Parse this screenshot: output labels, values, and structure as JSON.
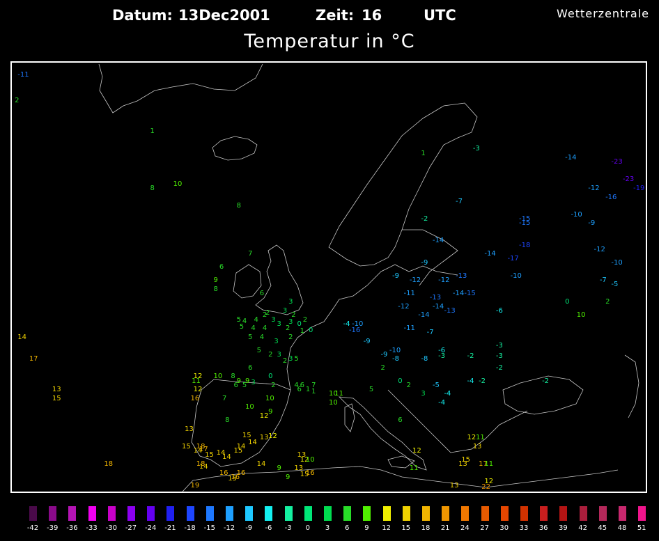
{
  "header": {
    "datum_label": "Datum:",
    "datum_value": "13Dec2001",
    "zeit_label": "Zeit:",
    "zeit_value": "16",
    "utc_label": "UTC",
    "title": "Temperatur in °C",
    "credit": "Wetterzentrale"
  },
  "legend": {
    "values": [
      "-42",
      "-39",
      "-36",
      "-33",
      "-30",
      "-27",
      "-24",
      "-21",
      "-18",
      "-15",
      "-12",
      "-9",
      "-6",
      "-3",
      "0",
      "3",
      "6",
      "9",
      "12",
      "15",
      "18",
      "21",
      "24",
      "27",
      "30",
      "33",
      "36",
      "39",
      "42",
      "45",
      "48",
      "51"
    ],
    "colors": [
      "#4a0a4a",
      "#8a0a8a",
      "#b414b4",
      "#f000f0",
      "#c800c8",
      "#8c00f0",
      "#6400f0",
      "#2020f0",
      "#1e46ff",
      "#1e78ff",
      "#1ea0ff",
      "#1ec8ff",
      "#14f0f0",
      "#14f0a0",
      "#00e678",
      "#00dc50",
      "#28dc28",
      "#50f000",
      "#f0f000",
      "#f0d200",
      "#f0b400",
      "#f09600",
      "#f07800",
      "#e65a00",
      "#e64600",
      "#d23200",
      "#c81e1e",
      "#b41414",
      "#aa1e3c",
      "#b4285a",
      "#c8286e",
      "#f0148c"
    ]
  },
  "observations": [
    {
      "t": "-11",
      "lon": -45,
      "lat": 77,
      "c": "#1e78ff"
    },
    {
      "t": "2",
      "lon": -45.5,
      "lat": 74,
      "c": "#28dc28"
    },
    {
      "t": "1",
      "lon": -22,
      "lat": 70.5,
      "c": "#28dc28"
    },
    {
      "t": "10",
      "lon": -18,
      "lat": 64.5,
      "c": "#50f000"
    },
    {
      "t": "8",
      "lon": -22,
      "lat": 64,
      "c": "#28dc28"
    },
    {
      "t": "8",
      "lon": -7,
      "lat": 62,
      "c": "#28dc28"
    },
    {
      "t": "1",
      "lon": 25,
      "lat": 68,
      "c": "#28dc28"
    },
    {
      "t": "-3",
      "lon": 34,
      "lat": 68.5,
      "c": "#14f0a0"
    },
    {
      "t": "-14",
      "lon": 50,
      "lat": 67.5,
      "c": "#1ea0ff"
    },
    {
      "t": "-23",
      "lon": 58,
      "lat": 67,
      "c": "#6400f0"
    },
    {
      "t": "-23",
      "lon": 60,
      "lat": 65,
      "c": "#6400f0"
    },
    {
      "t": "-19",
      "lon": 64,
      "lat": 64,
      "c": "#2020f0"
    },
    {
      "t": "-12",
      "lon": 54,
      "lat": 64,
      "c": "#1ea0ff"
    },
    {
      "t": "-16",
      "lon": 57,
      "lat": 63,
      "c": "#1e78ff"
    },
    {
      "t": "-7",
      "lon": 31,
      "lat": 62.5,
      "c": "#1ec8ff"
    },
    {
      "t": "-2",
      "lon": 25,
      "lat": 60.5,
      "c": "#14f0a0"
    },
    {
      "t": "-15",
      "lon": 42,
      "lat": 60.5,
      "c": "#1e78ff"
    },
    {
      "t": "-15",
      "lon": 42,
      "lat": 60,
      "c": "#1e78ff"
    },
    {
      "t": "-10",
      "lon": 51,
      "lat": 61,
      "c": "#1ea0ff"
    },
    {
      "t": "-9",
      "lon": 54,
      "lat": 60,
      "c": "#1ea0ff"
    },
    {
      "t": "-14",
      "lon": 27,
      "lat": 58,
      "c": "#1ea0ff"
    },
    {
      "t": "-18",
      "lon": 42,
      "lat": 57.5,
      "c": "#1e46ff"
    },
    {
      "t": "-12",
      "lon": 55,
      "lat": 57,
      "c": "#1ea0ff"
    },
    {
      "t": "-14",
      "lon": 36,
      "lat": 56.5,
      "c": "#1ea0ff"
    },
    {
      "t": "-17",
      "lon": 40,
      "lat": 56,
      "c": "#1e46ff"
    },
    {
      "t": "-10",
      "lon": 58,
      "lat": 55.5,
      "c": "#1ea0ff"
    },
    {
      "t": "-9",
      "lon": 25,
      "lat": 55.5,
      "c": "#1ec8ff"
    },
    {
      "t": "-10",
      "lon": 40.5,
      "lat": 54,
      "c": "#1ea0ff"
    },
    {
      "t": "-7",
      "lon": 56,
      "lat": 53.5,
      "c": "#1ec8ff"
    },
    {
      "t": "-5",
      "lon": 58,
      "lat": 53,
      "c": "#1ec8ff"
    },
    {
      "t": "-9",
      "lon": 20,
      "lat": 54,
      "c": "#1ec8ff"
    },
    {
      "t": "-12",
      "lon": 23,
      "lat": 53.5,
      "c": "#1ea0ff"
    },
    {
      "t": "-12",
      "lon": 28,
      "lat": 53.5,
      "c": "#1ea0ff"
    },
    {
      "t": "-13",
      "lon": 31,
      "lat": 54,
      "c": "#1e78ff"
    },
    {
      "t": "-11",
      "lon": 22,
      "lat": 52,
      "c": "#1ea0ff"
    },
    {
      "t": "-13",
      "lon": 26.5,
      "lat": 51.5,
      "c": "#1e78ff"
    },
    {
      "t": "-14",
      "lon": 30.5,
      "lat": 52,
      "c": "#1ea0ff"
    },
    {
      "t": "-15",
      "lon": 32.5,
      "lat": 52,
      "c": "#1e78ff"
    },
    {
      "t": "-12",
      "lon": 21,
      "lat": 50.5,
      "c": "#1ea0ff"
    },
    {
      "t": "-14",
      "lon": 24.5,
      "lat": 49.5,
      "c": "#1ea0ff"
    },
    {
      "t": "-14",
      "lon": 27,
      "lat": 50.5,
      "c": "#1ea0ff"
    },
    {
      "t": "-13",
      "lon": 29,
      "lat": 50,
      "c": "#1e78ff"
    },
    {
      "t": "-6",
      "lon": 38,
      "lat": 50,
      "c": "#14f0f0"
    },
    {
      "t": "0",
      "lon": 50,
      "lat": 51,
      "c": "#00e678"
    },
    {
      "t": "10",
      "lon": 52,
      "lat": 49.5,
      "c": "#50f000"
    },
    {
      "t": "2",
      "lon": 57,
      "lat": 51,
      "c": "#28dc28"
    },
    {
      "t": "-10",
      "lon": 13,
      "lat": 48.5,
      "c": "#1ea0ff"
    },
    {
      "t": "-4",
      "lon": 11.5,
      "lat": 48.5,
      "c": "#14f0f0"
    },
    {
      "t": "-16",
      "lon": 12.5,
      "lat": 47.8,
      "c": "#1e78ff"
    },
    {
      "t": "-11",
      "lon": 22,
      "lat": 48,
      "c": "#1ea0ff"
    },
    {
      "t": "-7",
      "lon": 26,
      "lat": 47.5,
      "c": "#1ec8ff"
    },
    {
      "t": "-9",
      "lon": 15,
      "lat": 46.5,
      "c": "#1ec8ff"
    },
    {
      "t": "-10",
      "lon": 19.5,
      "lat": 45.5,
      "c": "#1ea0ff"
    },
    {
      "t": "-9",
      "lon": 18,
      "lat": 45,
      "c": "#1ec8ff"
    },
    {
      "t": "-8",
      "lon": 20,
      "lat": 44.5,
      "c": "#1ec8ff"
    },
    {
      "t": "-8",
      "lon": 25,
      "lat": 44.5,
      "c": "#1ec8ff"
    },
    {
      "t": "-6",
      "lon": 28,
      "lat": 45.5,
      "c": "#14f0f0"
    },
    {
      "t": "-3",
      "lon": 28,
      "lat": 44.8,
      "c": "#14f0a0"
    },
    {
      "t": "-2",
      "lon": 33,
      "lat": 44.8,
      "c": "#14f0a0"
    },
    {
      "t": "-3",
      "lon": 38,
      "lat": 46,
      "c": "#14f0a0"
    },
    {
      "t": "-3",
      "lon": 38,
      "lat": 44.8,
      "c": "#14f0a0"
    },
    {
      "t": "-2",
      "lon": 38,
      "lat": 43.5,
      "c": "#14f0a0"
    },
    {
      "t": "-2",
      "lon": 46,
      "lat": 42,
      "c": "#14f0a0"
    },
    {
      "t": "-4",
      "lon": 33,
      "lat": 42,
      "c": "#14f0f0"
    },
    {
      "t": "-2",
      "lon": 35,
      "lat": 42,
      "c": "#14f0a0"
    },
    {
      "t": "-5",
      "lon": 27,
      "lat": 41.5,
      "c": "#1ec8ff"
    },
    {
      "t": "-4",
      "lon": 29,
      "lat": 40.5,
      "c": "#14f0f0"
    },
    {
      "t": "-4",
      "lon": 28,
      "lat": 39.5,
      "c": "#14f0f0"
    },
    {
      "t": "0",
      "lon": 21,
      "lat": 42,
      "c": "#00e678"
    },
    {
      "t": "2",
      "lon": 22.5,
      "lat": 41.5,
      "c": "#28dc28"
    },
    {
      "t": "3",
      "lon": 25,
      "lat": 40.5,
      "c": "#00dc50"
    },
    {
      "t": "5",
      "lon": 16,
      "lat": 41,
      "c": "#28dc28"
    },
    {
      "t": "2",
      "lon": 18,
      "lat": 43.5,
      "c": "#28dc28"
    },
    {
      "t": "6",
      "lon": 21,
      "lat": 37.5,
      "c": "#28dc28"
    },
    {
      "t": "12",
      "lon": 23.5,
      "lat": 34,
      "c": "#f0f000"
    },
    {
      "t": "11",
      "lon": 23,
      "lat": 32,
      "c": "#50f000"
    },
    {
      "t": "12",
      "lon": 33,
      "lat": 35.5,
      "c": "#f0f000"
    },
    {
      "t": "11",
      "lon": 34.5,
      "lat": 35.5,
      "c": "#50f000"
    },
    {
      "t": "13",
      "lon": 34,
      "lat": 34.5,
      "c": "#f0d200"
    },
    {
      "t": "15",
      "lon": 32,
      "lat": 33,
      "c": "#f0d200"
    },
    {
      "t": "13",
      "lon": 31.5,
      "lat": 32.5,
      "c": "#f0d200"
    },
    {
      "t": "17",
      "lon": 35,
      "lat": 32.5,
      "c": "#f0b400"
    },
    {
      "t": "11",
      "lon": 36,
      "lat": 32.5,
      "c": "#50f000"
    },
    {
      "t": "12",
      "lon": 36,
      "lat": 30.5,
      "c": "#f0f000"
    },
    {
      "t": "22",
      "lon": 35.5,
      "lat": 29,
      "c": "#f09600"
    },
    {
      "t": "6",
      "lon": -10,
      "lat": 55,
      "c": "#28dc28"
    },
    {
      "t": "7",
      "lon": -5,
      "lat": 56.5,
      "c": "#28dc28"
    },
    {
      "t": "9",
      "lon": -11,
      "lat": 53.5,
      "c": "#50f000"
    },
    {
      "t": "8",
      "lon": -11,
      "lat": 52.5,
      "c": "#28dc28"
    },
    {
      "t": "6",
      "lon": -3,
      "lat": 52,
      "c": "#28dc28"
    },
    {
      "t": "3",
      "lon": 2,
      "lat": 51,
      "c": "#00dc50"
    },
    {
      "t": "3",
      "lon": 1,
      "lat": 50,
      "c": "#00dc50"
    },
    {
      "t": "2",
      "lon": -2.5,
      "lat": 49.5,
      "c": "#28dc28"
    },
    {
      "t": "4",
      "lon": -4,
      "lat": 49,
      "c": "#28dc28"
    },
    {
      "t": "2",
      "lon": -2,
      "lat": 49.8,
      "c": "#28dc28"
    },
    {
      "t": "3",
      "lon": -1,
      "lat": 49,
      "c": "#00dc50"
    },
    {
      "t": "2",
      "lon": 2.5,
      "lat": 49.5,
      "c": "#28dc28"
    },
    {
      "t": "2",
      "lon": 4.5,
      "lat": 49,
      "c": "#28dc28"
    },
    {
      "t": "5",
      "lon": -7,
      "lat": 49,
      "c": "#28dc28"
    },
    {
      "t": "4",
      "lon": -6,
      "lat": 48.8,
      "c": "#28dc28"
    },
    {
      "t": "5",
      "lon": -6.5,
      "lat": 48.2,
      "c": "#28dc28"
    },
    {
      "t": "4",
      "lon": -4.5,
      "lat": 48,
      "c": "#28dc28"
    },
    {
      "t": "4",
      "lon": -2.5,
      "lat": 48,
      "c": "#28dc28"
    },
    {
      "t": "3",
      "lon": 0,
      "lat": 48.5,
      "c": "#00dc50"
    },
    {
      "t": "2",
      "lon": 1.5,
      "lat": 48,
      "c": "#28dc28"
    },
    {
      "t": "3",
      "lon": 2,
      "lat": 48.7,
      "c": "#00dc50"
    },
    {
      "t": "0",
      "lon": 3.5,
      "lat": 48.5,
      "c": "#00e678"
    },
    {
      "t": "1",
      "lon": 4,
      "lat": 47.7,
      "c": "#28dc28"
    },
    {
      "t": "0",
      "lon": 5.5,
      "lat": 47.8,
      "c": "#00e678"
    },
    {
      "t": "5",
      "lon": -5,
      "lat": 47,
      "c": "#28dc28"
    },
    {
      "t": "4",
      "lon": -3,
      "lat": 47,
      "c": "#28dc28"
    },
    {
      "t": "3",
      "lon": -0.5,
      "lat": 46.5,
      "c": "#00dc50"
    },
    {
      "t": "2",
      "lon": 2,
      "lat": 47,
      "c": "#28dc28"
    },
    {
      "t": "5",
      "lon": -3.5,
      "lat": 45.5,
      "c": "#28dc28"
    },
    {
      "t": "2",
      "lon": -1.5,
      "lat": 45,
      "c": "#28dc28"
    },
    {
      "t": "3",
      "lon": 0,
      "lat": 45,
      "c": "#00dc50"
    },
    {
      "t": "2",
      "lon": 1,
      "lat": 44.3,
      "c": "#28dc28"
    },
    {
      "t": "3",
      "lon": 2,
      "lat": 44.5,
      "c": "#00dc50"
    },
    {
      "t": "5",
      "lon": 3,
      "lat": 44.5,
      "c": "#28dc28"
    },
    {
      "t": "6",
      "lon": -5,
      "lat": 43.5,
      "c": "#28dc28"
    },
    {
      "t": "0",
      "lon": -1.5,
      "lat": 42.5,
      "c": "#00e678"
    },
    {
      "t": "2",
      "lon": -1,
      "lat": 41.5,
      "c": "#28dc28"
    },
    {
      "t": "4",
      "lon": 3,
      "lat": 41.5,
      "c": "#28dc28"
    },
    {
      "t": "6",
      "lon": 3.5,
      "lat": 41,
      "c": "#28dc28"
    },
    {
      "t": "1",
      "lon": 5,
      "lat": 41,
      "c": "#28dc28"
    },
    {
      "t": "7",
      "lon": 6,
      "lat": 41.5,
      "c": "#28dc28"
    },
    {
      "t": "6",
      "lon": 4,
      "lat": 41.5,
      "c": "#28dc28"
    },
    {
      "t": "1",
      "lon": 6,
      "lat": 40.8,
      "c": "#28dc28"
    },
    {
      "t": "8",
      "lon": -8,
      "lat": 42.5,
      "c": "#28dc28"
    },
    {
      "t": "9",
      "lon": -7,
      "lat": 42,
      "c": "#50f000"
    },
    {
      "t": "9",
      "lon": -5.5,
      "lat": 42,
      "c": "#50f000"
    },
    {
      "t": "5",
      "lon": -6,
      "lat": 41.5,
      "c": "#28dc28"
    },
    {
      "t": "6",
      "lon": -7.5,
      "lat": 41.5,
      "c": "#28dc28"
    },
    {
      "t": "3",
      "lon": -4.5,
      "lat": 41.8,
      "c": "#00dc50"
    },
    {
      "t": "10",
      "lon": -11,
      "lat": 42.5,
      "c": "#50f000"
    },
    {
      "t": "12",
      "lon": -14.5,
      "lat": 42.5,
      "c": "#f0f000"
    },
    {
      "t": "11",
      "lon": -14.8,
      "lat": 42,
      "c": "#50f000"
    },
    {
      "t": "12",
      "lon": -14.5,
      "lat": 41,
      "c": "#f0f000"
    },
    {
      "t": "16",
      "lon": -15,
      "lat": 40,
      "c": "#f0b400"
    },
    {
      "t": "7",
      "lon": -9.5,
      "lat": 40,
      "c": "#28dc28"
    },
    {
      "t": "10",
      "lon": -5.5,
      "lat": 39,
      "c": "#50f000"
    },
    {
      "t": "10",
      "lon": -2,
      "lat": 40,
      "c": "#50f000"
    },
    {
      "t": "9",
      "lon": -1.5,
      "lat": 38.5,
      "c": "#50f000"
    },
    {
      "t": "12",
      "lon": -3,
      "lat": 38,
      "c": "#f0f000"
    },
    {
      "t": "8",
      "lon": -9,
      "lat": 37.5,
      "c": "#28dc28"
    },
    {
      "t": "13",
      "lon": -16,
      "lat": 36.5,
      "c": "#f0d200"
    },
    {
      "t": "15",
      "lon": -6,
      "lat": 35.8,
      "c": "#f0d200"
    },
    {
      "t": "13",
      "lon": -3,
      "lat": 35.5,
      "c": "#f0d200"
    },
    {
      "t": "12",
      "lon": -1.5,
      "lat": 35.7,
      "c": "#f0f000"
    },
    {
      "t": "15",
      "lon": -16.5,
      "lat": 34.5,
      "c": "#f0d200"
    },
    {
      "t": "18",
      "lon": -14,
      "lat": 34.5,
      "c": "#f0b400"
    },
    {
      "t": "17",
      "lon": -13.5,
      "lat": 34.2,
      "c": "#f0b400"
    },
    {
      "t": "14",
      "lon": -14.5,
      "lat": 34,
      "c": "#f0d200"
    },
    {
      "t": "15",
      "lon": -12.5,
      "lat": 33.5,
      "c": "#f0d200"
    },
    {
      "t": "14",
      "lon": -10.5,
      "lat": 33.8,
      "c": "#f0d200"
    },
    {
      "t": "14",
      "lon": -9.5,
      "lat": 33.3,
      "c": "#f0d200"
    },
    {
      "t": "15",
      "lon": -7.5,
      "lat": 34,
      "c": "#f0d200"
    },
    {
      "t": "14",
      "lon": -7,
      "lat": 34.5,
      "c": "#f0d200"
    },
    {
      "t": "14",
      "lon": -5,
      "lat": 35,
      "c": "#f0d200"
    },
    {
      "t": "18",
      "lon": -14,
      "lat": 32.5,
      "c": "#f0b400"
    },
    {
      "t": "14",
      "lon": -13.5,
      "lat": 32.2,
      "c": "#f0d200"
    },
    {
      "t": "16",
      "lon": -10,
      "lat": 31.5,
      "c": "#f0b400"
    },
    {
      "t": "16",
      "lon": -7,
      "lat": 31.5,
      "c": "#f0b400"
    },
    {
      "t": "16",
      "lon": -8,
      "lat": 31,
      "c": "#f0b400"
    },
    {
      "t": "15",
      "lon": -8.5,
      "lat": 30.8,
      "c": "#f0d200"
    },
    {
      "t": "14",
      "lon": -3.5,
      "lat": 32.5,
      "c": "#f0d200"
    },
    {
      "t": "9",
      "lon": 0,
      "lat": 32,
      "c": "#50f000"
    },
    {
      "t": "9",
      "lon": 1.5,
      "lat": 31,
      "c": "#50f000"
    },
    {
      "t": "13",
      "lon": 3,
      "lat": 32,
      "c": "#f0d200"
    },
    {
      "t": "13",
      "lon": 3.5,
      "lat": 33.5,
      "c": "#f0d200"
    },
    {
      "t": "12",
      "lon": 4,
      "lat": 33,
      "c": "#f0f000"
    },
    {
      "t": "10",
      "lon": 5,
      "lat": 33,
      "c": "#50f000"
    },
    {
      "t": "15",
      "lon": 4,
      "lat": 31.3,
      "c": "#f0d200"
    },
    {
      "t": "16",
      "lon": 5,
      "lat": 31.5,
      "c": "#f0b400"
    },
    {
      "t": "19",
      "lon": -15,
      "lat": 30,
      "c": "#f0b400"
    },
    {
      "t": "13",
      "lon": 30,
      "lat": 30,
      "c": "#f0d200"
    },
    {
      "t": "10",
      "lon": 9,
      "lat": 40.5,
      "c": "#50f000"
    },
    {
      "t": "10",
      "lon": 9,
      "lat": 39.5,
      "c": "#50f000"
    },
    {
      "t": "11",
      "lon": 10,
      "lat": 40.5,
      "c": "#50f000"
    },
    {
      "t": "18",
      "lon": -30,
      "lat": 32.5,
      "c": "#f0b400"
    },
    {
      "t": "14",
      "lon": -45,
      "lat": 47,
      "c": "#f0d200"
    },
    {
      "t": "17",
      "lon": -43,
      "lat": 44.5,
      "c": "#f0b400"
    },
    {
      "t": "13",
      "lon": -39,
      "lat": 41,
      "c": "#f0d200"
    },
    {
      "t": "15",
      "lon": -39,
      "lat": 40,
      "c": "#f0d200"
    }
  ]
}
